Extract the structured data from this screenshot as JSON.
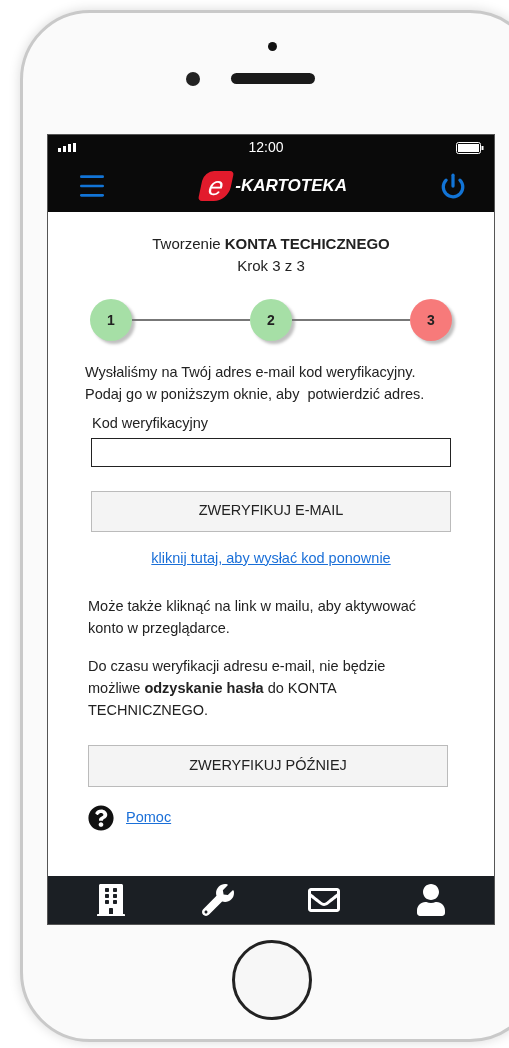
{
  "status_bar": {
    "time": "12:00"
  },
  "header": {
    "logo_letter": "e",
    "logo_text": "-KARTOTEKA"
  },
  "title": {
    "text": "Tworzenie **KONTA TECHICZNEGO**",
    "subtitle": "Krok 3 z 3"
  },
  "steps": [
    {
      "label": "1",
      "selected": false
    },
    {
      "label": "2",
      "selected": false
    },
    {
      "label": "3",
      "selected": true
    }
  ],
  "intro": [
    "Wysłaliśmy na Twój adres e-mail kod weryfikacyjny.",
    "Podaj go w poniższym oknie, aby  potwierdzić adres."
  ],
  "code_field": {
    "label": "Kod weryfikacyjny"
  },
  "verify_button": "ZWERYFIKUJ E-MAIL",
  "resend_link": "kliknij tutaj, aby wysłać kod ponownie",
  "info_1": [
    "Może także kliknąć na link w mailu, aby aktywować",
    "konto w przeglądarce."
  ],
  "info_2": [
    "Do czasu weryfikacji adresu e-mail, nie będzie",
    "możliwe **odzyskanie hasła** do KONTA",
    "TECHNICZNEGO."
  ],
  "later_button": "ZWERYFIKUJ PÓŹNIEJ",
  "help_link": "Pomoc",
  "bottom_nav": [
    {
      "kind": "building"
    },
    {
      "kind": "wrench"
    },
    {
      "kind": "mail"
    },
    {
      "kind": "user"
    }
  ]
}
